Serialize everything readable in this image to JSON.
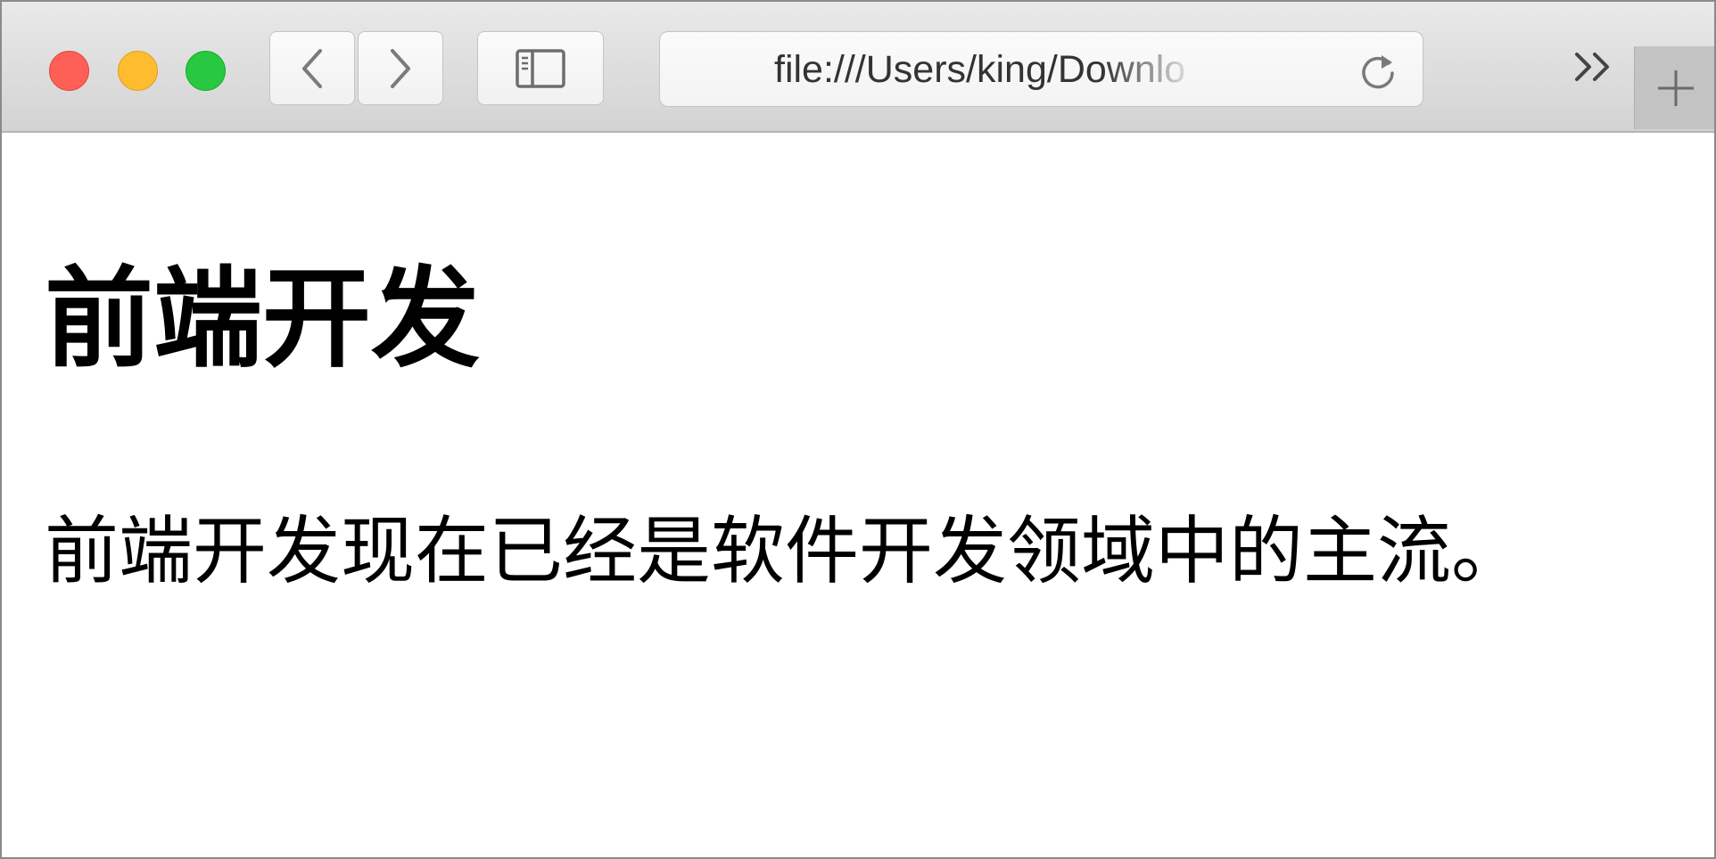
{
  "browser": {
    "address_bar": {
      "url": "file:///Users/king/Downloads"
    },
    "toolbar": {
      "back_icon": "chevron-left-icon",
      "forward_icon": "chevron-right-icon",
      "sidebar_icon": "sidebar-icon",
      "reload_icon": "reload-icon",
      "overflow_icon": "double-chevron-right-icon",
      "new_tab_icon": "plus-icon"
    },
    "traffic_lights": {
      "close_color": "#fe5f57",
      "minimize_color": "#febc2e",
      "maximize_color": "#28c840"
    }
  },
  "page": {
    "heading": "前端开发",
    "paragraph": "前端开发现在已经是软件开发领域中的主流。"
  }
}
